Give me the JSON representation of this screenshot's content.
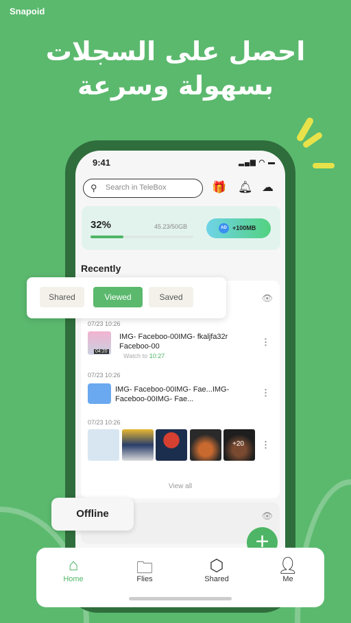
{
  "brand": "Snapoid",
  "headline": [
    "احصل على السجلات",
    "بسهولة وسرعة"
  ],
  "status": {
    "time": "9:41",
    "icons": "signal wifi battery"
  },
  "search": {
    "placeholder": "Search in TeleBox",
    "icon": "search-icon"
  },
  "top_icons": [
    "gift-icon",
    "bell-icon",
    "cloud-upload-icon"
  ],
  "storage": {
    "percent_label": "32%",
    "percent": 32,
    "usage": "45.23/50GB",
    "ad_badge": "AD",
    "ad_button": "+100MB"
  },
  "section_title": "Recently",
  "filter_tabs": [
    {
      "label": "Shared"
    },
    {
      "label": "Viewed",
      "active": true
    },
    {
      "label": "Saved"
    }
  ],
  "items": [
    {
      "time": "07/23 10:26",
      "title": "IMG- Faceboo-00IMG- fkaljfa32r Faceboo-00",
      "duration": "04:20",
      "watch_prefix": "Watch to",
      "watch_time": "10:27"
    },
    {
      "time": "07/23 10:26",
      "title": "IMG- Faceboo-00IMG- Fae...IMG- Faceboo-00IMG- Fae..."
    },
    {
      "time": "07/23 10:26",
      "more_count": "+20"
    }
  ],
  "view_all": "View all",
  "offline_label": "Offline",
  "nav": [
    {
      "label": "Home",
      "icon": "home-icon",
      "active": true
    },
    {
      "label": "Flies",
      "icon": "folder-icon"
    },
    {
      "label": "Shared",
      "icon": "cube-icon"
    },
    {
      "label": "Me",
      "icon": "person-icon"
    }
  ],
  "colors": {
    "background": "#5bb96e",
    "accent": "#4db565",
    "phone_frame": "#2f6e3c",
    "folder": "#6aa8ef"
  }
}
